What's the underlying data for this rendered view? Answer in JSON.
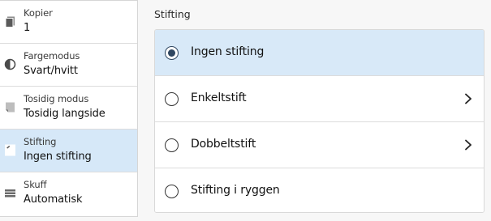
{
  "left_panel": {
    "items": [
      {
        "label": "Kopier",
        "value": "1",
        "icon": "copies-icon",
        "selected": false
      },
      {
        "label": "Fargemodus",
        "value": "Svart/hvitt",
        "icon": "color-mode-icon",
        "selected": false
      },
      {
        "label": "Tosidig modus",
        "value": "Tosidig langside",
        "icon": "duplex-icon",
        "selected": false
      },
      {
        "label": "Stifting",
        "value": "Ingen stifting",
        "icon": "staple-icon",
        "selected": true
      },
      {
        "label": "Skuff",
        "value": "Automatisk",
        "icon": "tray-icon",
        "selected": false
      }
    ]
  },
  "main": {
    "title": "Stifting",
    "options": [
      {
        "label": "Ingen stifting",
        "selected": true,
        "has_submenu": false
      },
      {
        "label": "Enkeltstift",
        "selected": false,
        "has_submenu": true
      },
      {
        "label": "Dobbeltstift",
        "selected": false,
        "has_submenu": true
      },
      {
        "label": "Stifting i ryggen",
        "selected": false,
        "has_submenu": false
      }
    ]
  },
  "colors": {
    "selected_background": "#d6e8f8",
    "radio_fill": "#2f4660",
    "border": "#d9d9d9"
  }
}
